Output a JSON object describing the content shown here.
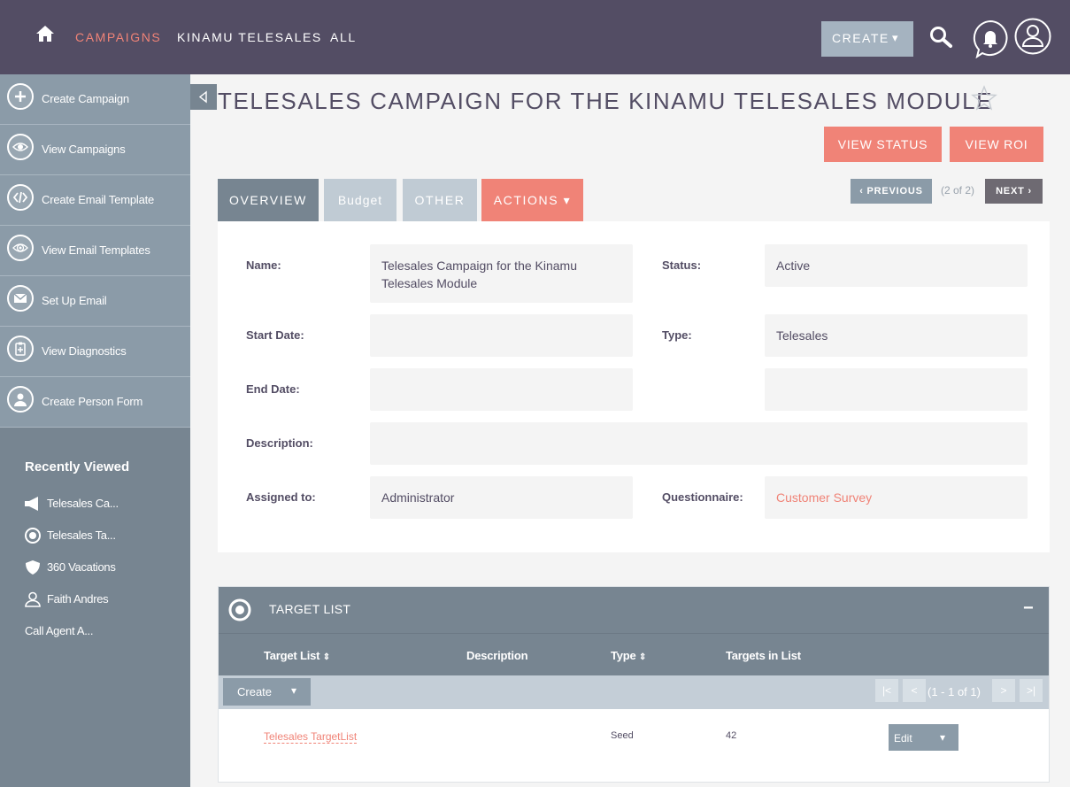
{
  "nav": {
    "links": [
      "CAMPAIGNS",
      "KINAMU TELESALES",
      "ALL"
    ],
    "create_label": "CREATE",
    "caret": "▾"
  },
  "sidebar": {
    "actions": [
      {
        "label": "Create Campaign",
        "icon": "plus-icon"
      },
      {
        "label": "View Campaigns",
        "icon": "eye-icon"
      },
      {
        "label": "Create Email Template",
        "icon": "code-icon"
      },
      {
        "label": "View Email Templates",
        "icon": "email-eye-icon"
      },
      {
        "label": "Set Up Email",
        "icon": "envelope-icon"
      },
      {
        "label": "View Diagnostics",
        "icon": "clipboard-icon"
      },
      {
        "label": "Create Person Form",
        "icon": "person-icon"
      }
    ],
    "recently_viewed_title": "Recently Viewed",
    "recently_viewed": [
      {
        "label": "Telesales Ca...",
        "icon": "megaphone-icon"
      },
      {
        "label": "Telesales Ta...",
        "icon": "target-icon"
      },
      {
        "label": "360 Vacations",
        "icon": "shield-icon"
      },
      {
        "label": "Faith Andres",
        "icon": "person-icon"
      },
      {
        "label": "Call Agent A...",
        "icon": ""
      }
    ]
  },
  "page": {
    "title": "TELESALES CAMPAIGN FOR THE KINAMU TELESALES MODULE",
    "view_status": "VIEW STATUS",
    "view_roi": "VIEW ROI"
  },
  "tabs": {
    "overview": "OVERVIEW",
    "budget": "Budget",
    "other": "OTHER",
    "actions": "ACTIONS ▾"
  },
  "pager": {
    "previous": "PREVIOUS",
    "count": "(2 of 2)",
    "next": "NEXT"
  },
  "detail": {
    "name_label": "Name:",
    "name_value": "Telesales Campaign for the Kinamu Telesales Module",
    "status_label": "Status:",
    "status_value": "Active",
    "start_label": "Start Date:",
    "start_value": "",
    "type_label": "Type:",
    "type_value": "Telesales",
    "end_label": "End Date:",
    "end_value": "",
    "description_label": "Description:",
    "description_value": "",
    "assigned_label": "Assigned to:",
    "assigned_value": "Administrator",
    "questionnaire_label": "Questionnaire:",
    "questionnaire_value": "Customer Survey"
  },
  "subpanel": {
    "title": "TARGET LIST",
    "minus": "−",
    "columns": [
      "Target List",
      "Description",
      "Type",
      "Targets in List"
    ],
    "sort_glyph": "⇕",
    "create_label": "Create",
    "page_text": "(1 - 1 of 1)",
    "pager_glyphs": [
      "|<",
      "<",
      ">",
      ">|"
    ],
    "rows": [
      {
        "name": "Telesales TargetList",
        "description": "",
        "type": "Seed",
        "count": "42",
        "action": "Edit"
      }
    ]
  },
  "colors": {
    "nav_bg": "#534d64",
    "accent": "#f08377",
    "sidebar": "#778591",
    "button_gray": "#8b9ba8"
  }
}
